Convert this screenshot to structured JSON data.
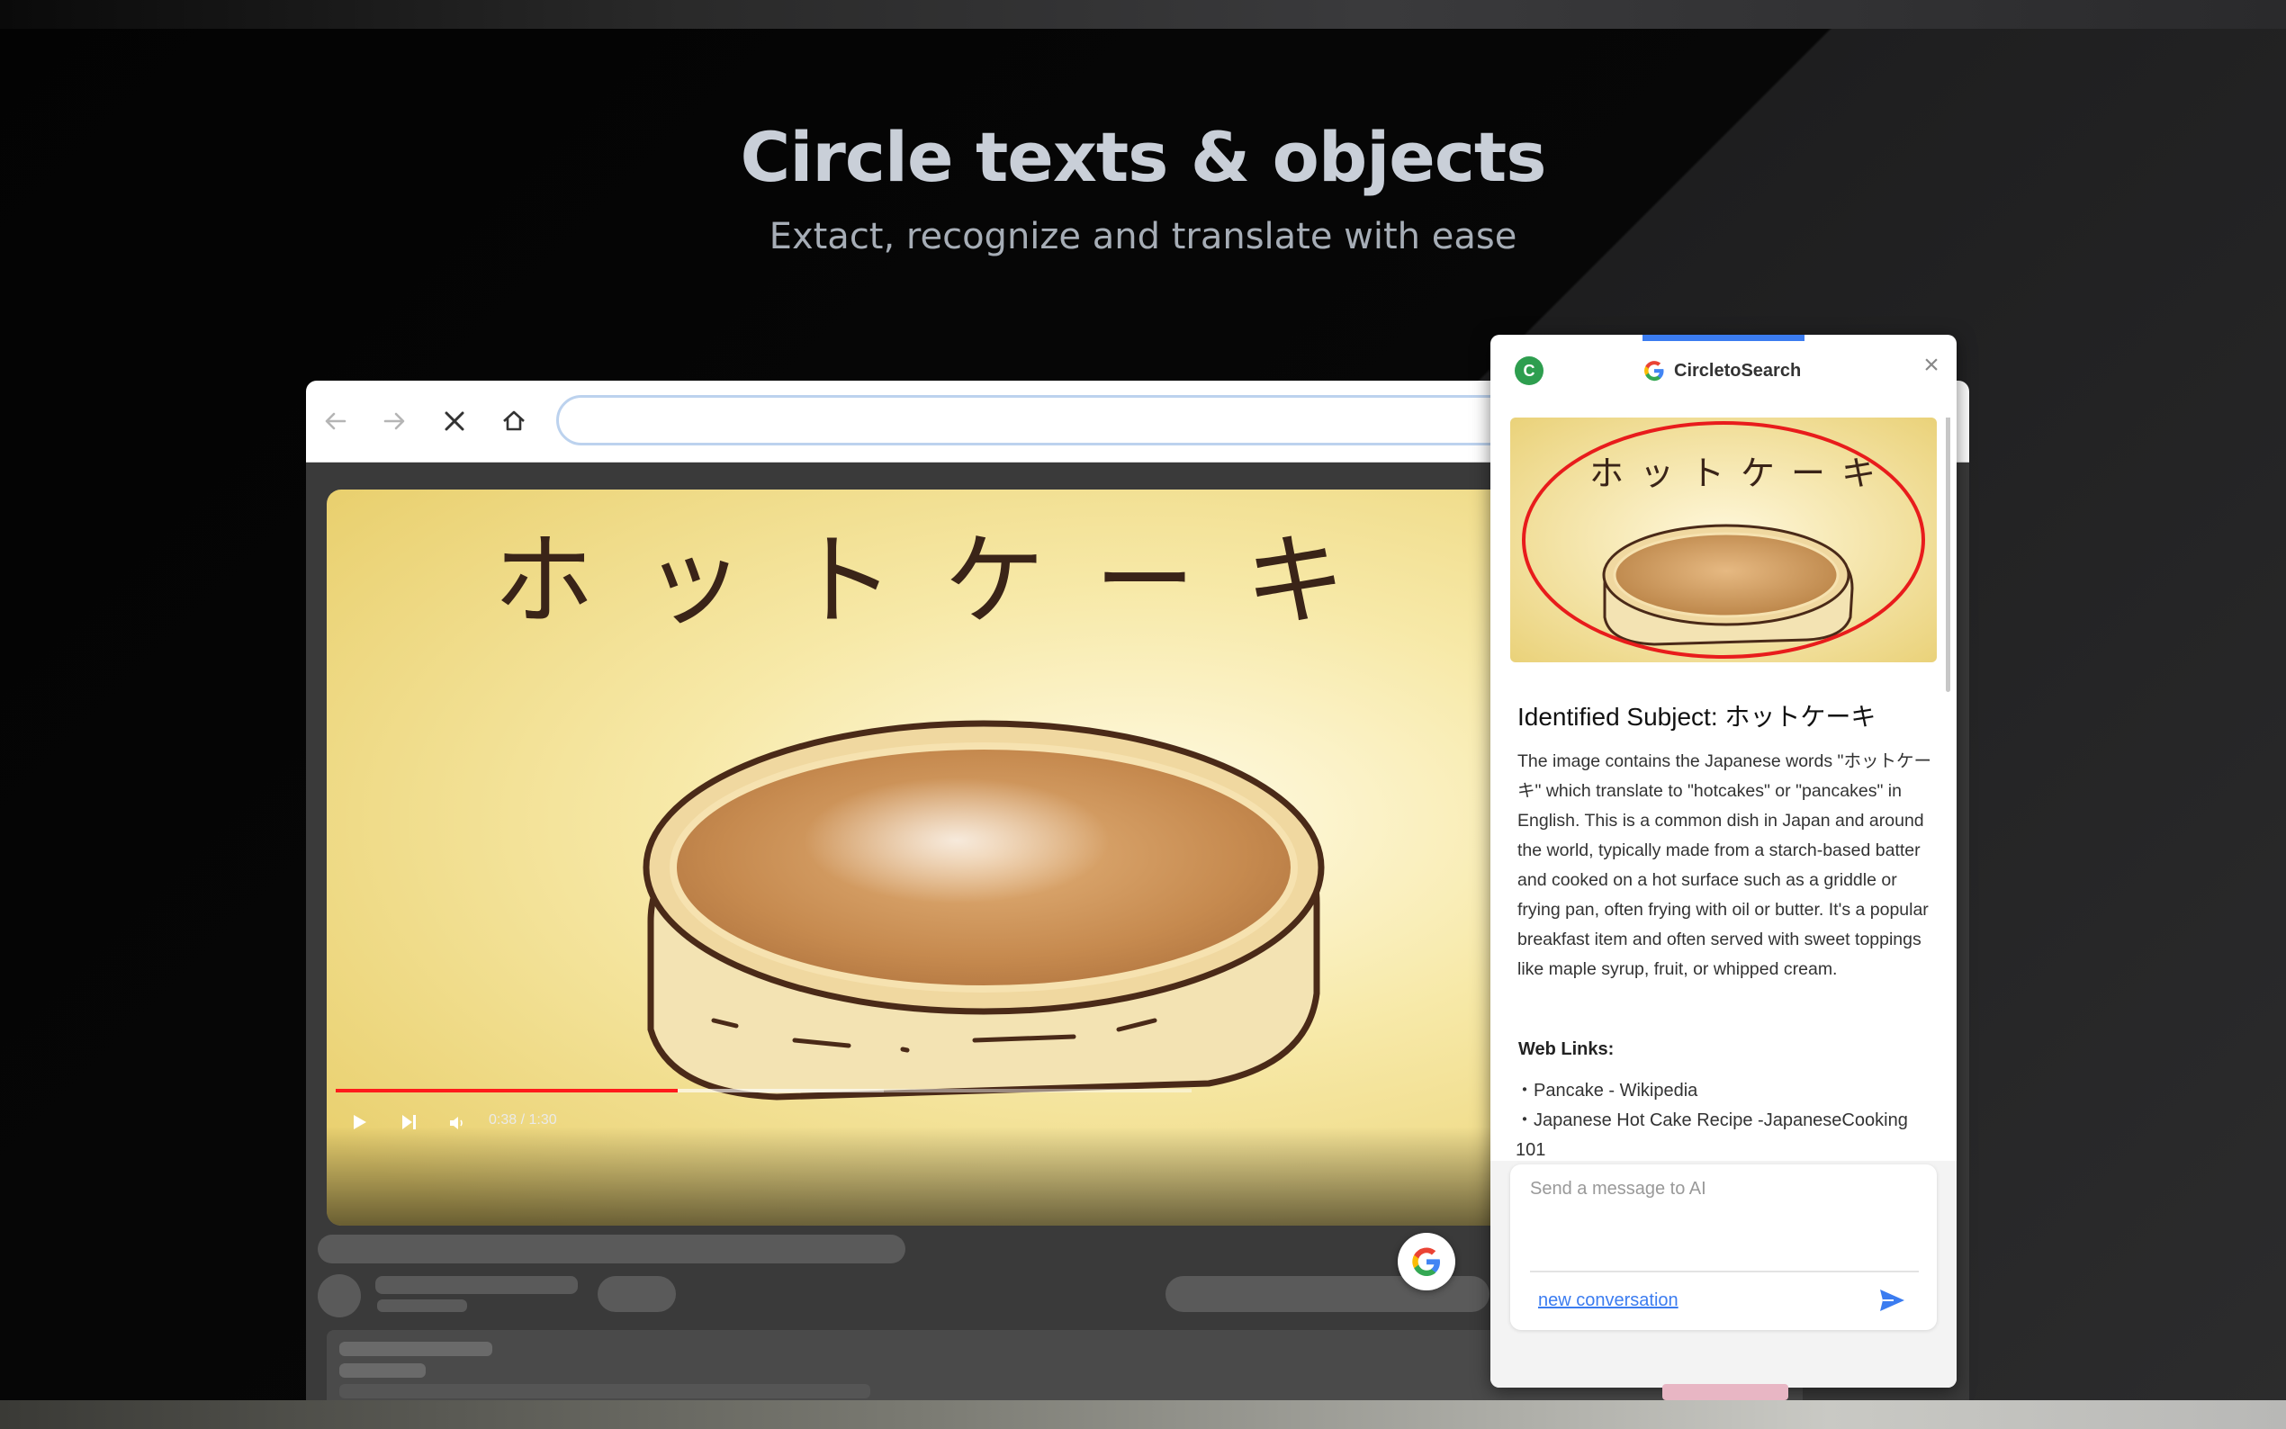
{
  "hero": {
    "title": "Circle texts & objects",
    "subtitle": "Extact, recognize and translate with ease"
  },
  "browser": {
    "toolbar_icons": [
      "back-arrow-icon",
      "forward-arrow-icon",
      "close-icon",
      "home-icon"
    ],
    "address_value": ""
  },
  "video": {
    "overlay_text": "ホットケーキ",
    "time": "0:38 / 1:30",
    "progress": 0.4,
    "buffered": 0.64,
    "progress_color": "#ff1b1b"
  },
  "panel": {
    "avatar_letter": "C",
    "brand": "CircletoSearch",
    "accent_color": "#3b7cf0",
    "identified_title": "Identified Subject: ホットケーキ",
    "description": "The image contains the Japanese words \"ホットケーキ\" which translate to \"hotcakes\" or \"pancakes\" in English. This is a common dish in Japan and around the world, typically made from a starch-based batter and cooked on a hot surface such as a griddle or frying pan, often frying with oil or butter. It's a popular breakfast item and often served with sweet toppings like maple syrup, fruit, or whipped cream.",
    "web_links_label": "Web Links:",
    "web_links": [
      "・Pancake - Wikipedia",
      "・Japanese Hot Cake Recipe -JapaneseCooking 101"
    ],
    "message_placeholder": "Send a message to AI",
    "new_conversation": "new conversation"
  }
}
